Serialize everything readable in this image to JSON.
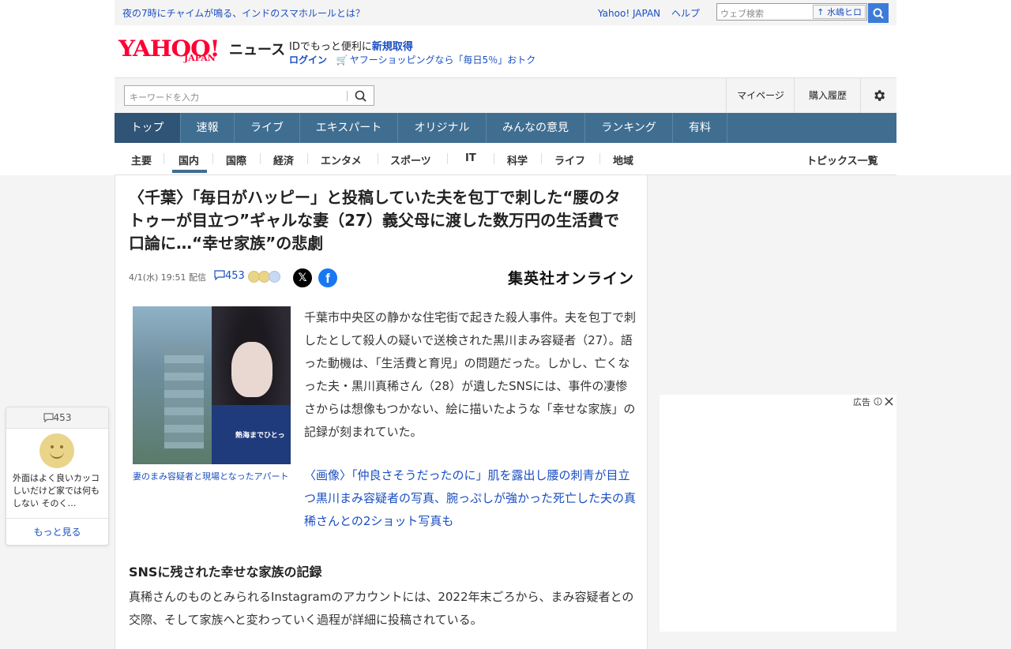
{
  "topbar": {
    "headline": "夜の7時にチャイムが鳴る、インドのスマホルールとは？",
    "yahoo_link": "Yahoo! JAPAN",
    "help_link": "ヘルプ",
    "search_placeholder": "ウェブ検索",
    "search_keyword": "水嶋ヒロ"
  },
  "brand": {
    "logo": "YAHOO!",
    "logo_sub": "JAPAN",
    "section": "ニュース",
    "id_prefix": "IDでもっと便利に",
    "id_link": "新規取得",
    "login": "ログイン",
    "promo": "ヤフーショッピングなら「毎日5％」おトク"
  },
  "searchrow": {
    "placeholder": "キーワードを入力",
    "mypage": "マイページ",
    "history": "購入履歴"
  },
  "mainnav": [
    "トップ",
    "速報",
    "ライブ",
    "エキスパート",
    "オリジナル",
    "みんなの意見",
    "ランキング",
    "有料"
  ],
  "subnav": {
    "items": [
      "主要",
      "国内",
      "国際",
      "経済",
      "エンタメ",
      "スポーツ",
      "IT",
      "科学",
      "ライフ",
      "地域"
    ],
    "active": "国内",
    "topics": "トピックス一覧"
  },
  "article": {
    "title": "〈千葉〉「毎日がハッピー」と投稿していた夫を包丁で刺した“腰のタトゥーが目立つ”ギャルな妻（27）義父母に渡した数万円の生活費で口論に…“幸せ家族”の悲劇",
    "date": "4/1(水) 19:51 配信",
    "comment_count": "453",
    "source": "集英社オンライン",
    "photo_overlay": "熱海までひとっ",
    "photo_caption": "妻のまみ容疑者と現場となったアパート",
    "body1": "千葉市中央区の静かな住宅街で起きた殺人事件。夫を包丁で刺したとして殺人の疑いで送検された黒川まみ容疑者（27）。語った動機は、「生活費と育児」の問題だった。しかし、亡くなった夫・黒川真稀さん（28）が遺したSNSには、事件の凄惨さからは想像もつかない、絵に描いたような「幸せな家族」の記録が刻まれていた。",
    "link1": "〈画像〉「仲良さそうだったのに」肌を露出し腰の刺青が目立つ黒川まみ容疑者の写真、腕っぷしが強かった死亡した夫の真稀さんとの2ショット写真も",
    "subhead": "SNSに残された幸せな家族の記録",
    "body2": "真稀さんのものとみられるInstagramのアカウントには、2022年末ごろから、まみ容疑者との交際、そして家族へと変わっていく過程が詳細に投稿されている。"
  },
  "comment_card": {
    "count": "453",
    "text": "外面はよく良いカッコしいだけど家では何もしない そのく…",
    "more": "もっと見る"
  },
  "ad": {
    "label": "広告"
  },
  "colors": {
    "accent": "#3f6e91",
    "logo_red": "#ff0033",
    "link": "#1a4ec2"
  }
}
